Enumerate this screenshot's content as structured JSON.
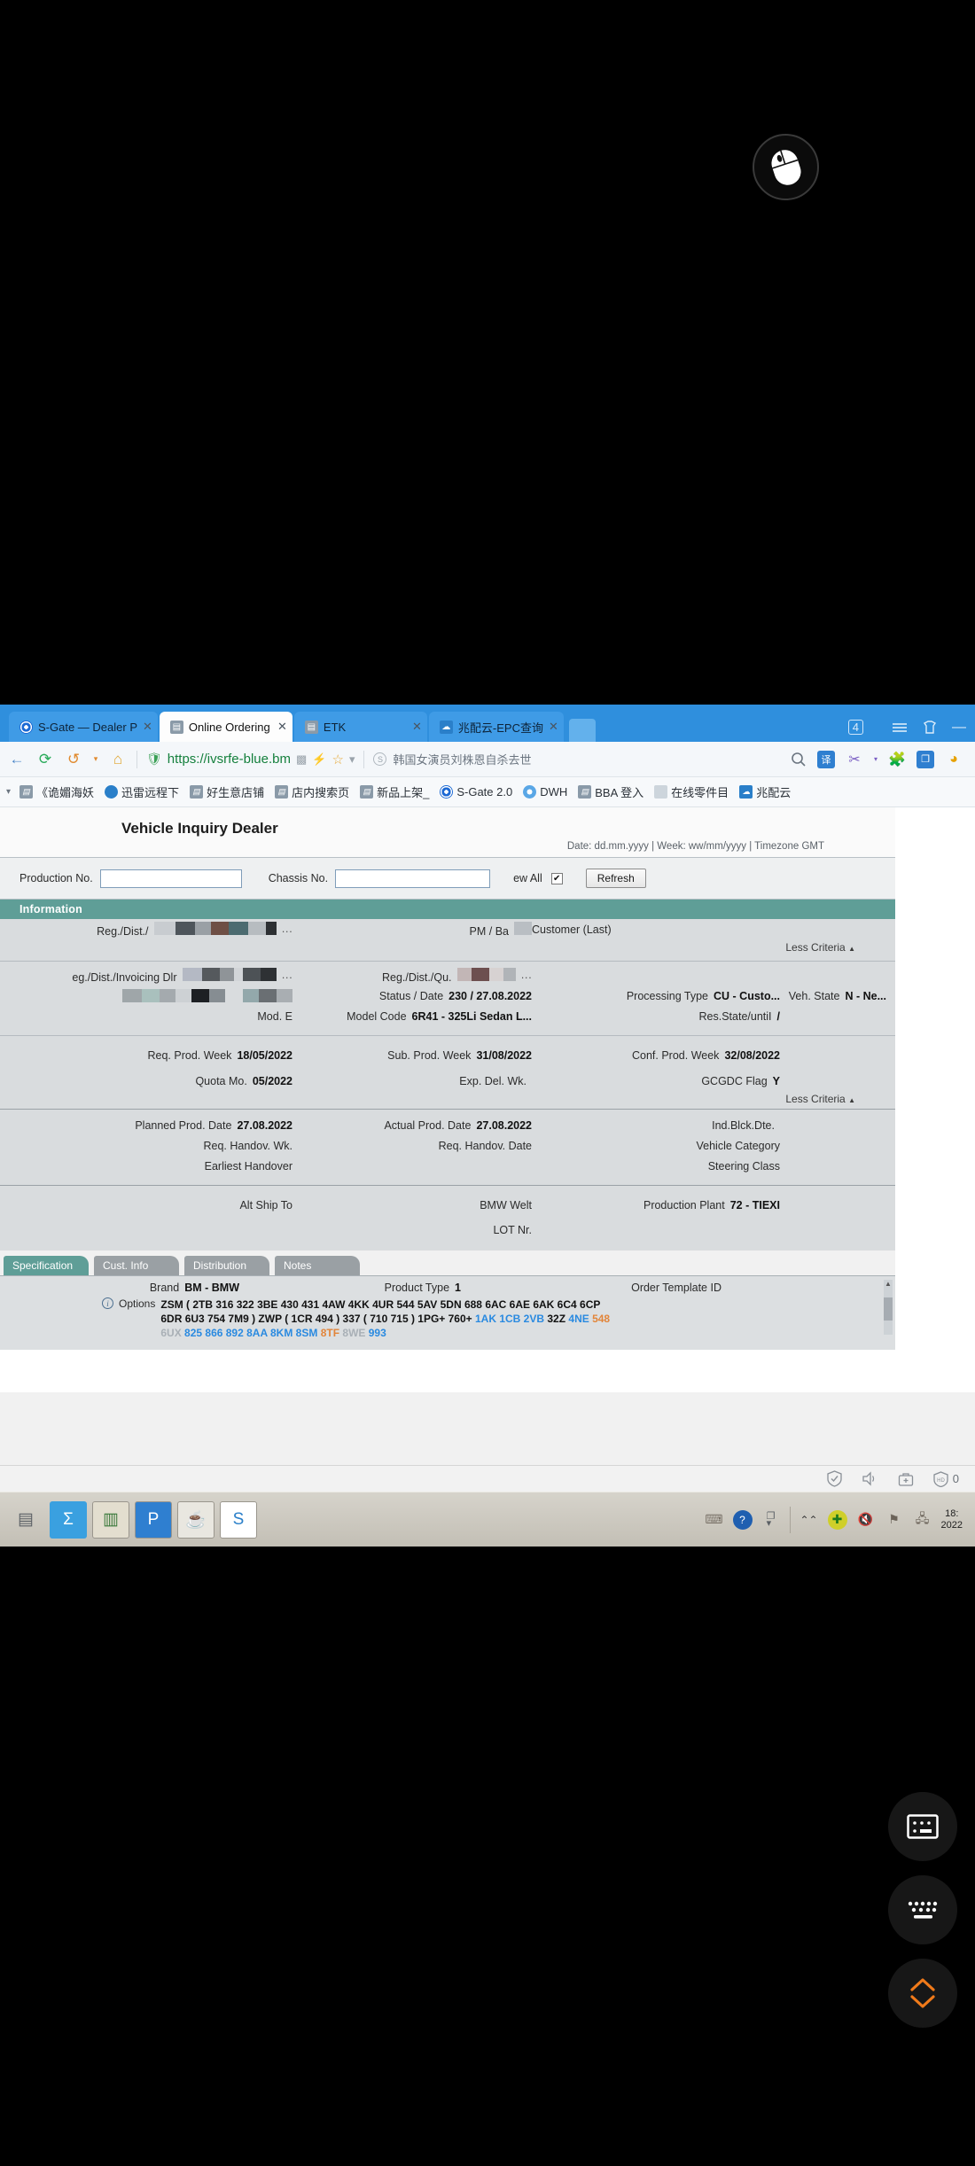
{
  "overlay": {
    "mouse_icon": "mouse-pointer-icon"
  },
  "browser": {
    "tabs": [
      {
        "title": "S-Gate — Dealer P",
        "icon": "bmw-favicon",
        "close": "✕",
        "active": false
      },
      {
        "title": "Online Ordering",
        "icon": "document-favicon",
        "close": "✕",
        "active": true
      },
      {
        "title": "ETK",
        "icon": "document-favicon",
        "close": "✕",
        "active": false
      },
      {
        "title": "兆配云-EPC查询",
        "icon": "blue-cloud-favicon",
        "close": "✕",
        "active": false
      }
    ],
    "window_controls": {
      "count_badge": "4",
      "menu_icon": "hamburger-menu-icon",
      "shirt_icon": "skin-icon",
      "minimize": "—"
    },
    "toolbar": {
      "back_icon": "←",
      "reload_icon": "⟳",
      "history_icon": "↺",
      "history_caret": "▾",
      "home_icon": "⌂",
      "site_shield_icon": "🛡",
      "url": "https://ivsrfe-blue.bm",
      "qr_icon": "qr-code-icon",
      "lightning_icon": "⚡",
      "star_icon": "☆",
      "star_caret": "▾",
      "search_engine_icon": "S",
      "search_text": "韩国女演员刘株恩自杀去世",
      "search_icon": "search-icon",
      "right_icons": [
        "translate-icon",
        "scissors-icon",
        "scissors-caret",
        "puzzle-extension-icon",
        "copy-window-icon",
        "account-icon"
      ]
    },
    "bookmarks_caret": "▾",
    "bookmarks": [
      {
        "label": "《诡媚海妖",
        "icon": "document-favicon"
      },
      {
        "label": "迅雷远程下",
        "icon": "xunlei-favicon"
      },
      {
        "label": "好生意店铺",
        "icon": "document-favicon"
      },
      {
        "label": "店内搜索页",
        "icon": "document-favicon"
      },
      {
        "label": "新品上架_",
        "icon": "document-favicon"
      },
      {
        "label": "S-Gate 2.0",
        "icon": "bmw-favicon"
      },
      {
        "label": "DWH",
        "icon": "dwh-favicon"
      },
      {
        "label": "BBA 登入",
        "icon": "document-favicon"
      },
      {
        "label": "在线零件目",
        "icon": "faint-favicon"
      },
      {
        "label": "兆配云",
        "icon": "blue-cloud-favicon"
      }
    ]
  },
  "app": {
    "title": "Vehicle Inquiry Dealer",
    "datebar": "Date: dd.mm.yyyy | Week: ww/mm/yyyy | Timezone GMT",
    "criteria": {
      "production_no_label": "Production No.",
      "chassis_no_label": "Chassis No.",
      "view_all_label": "ew All",
      "view_all_checked": "✔",
      "refresh_label": "Refresh"
    },
    "section_title": "Information",
    "less_criteria_label": "Less Criteria",
    "less_criteria_caret": "▲",
    "fields": {
      "reg_dist_label": "Reg./Dist./",
      "pm_ba_label": "PM / Ba",
      "customer_last_label": "Customer (Last)",
      "reg_dist_invoicing_label": "eg./Dist./Invoicing Dlr",
      "reg_dist_qu_label": "Reg./Dist./Qu.",
      "mod_e_label": "Mod. E",
      "status_date_label": "Status / Date",
      "status_date_value": "230 / 27.08.2022",
      "processing_type_label": "Processing Type",
      "processing_type_value": "CU - Custo...",
      "veh_state_label": "Veh. State",
      "veh_state_value": "N - Ne...",
      "model_code_label": "Model Code",
      "model_code_value": "6R41 - 325Li Sedan L...",
      "res_state_label": "Res.State/untiI",
      "res_state_value": "/",
      "req_prod_week_label": "Req. Prod. Week",
      "req_prod_week_value": "18/05/2022",
      "sub_prod_week_label": "Sub. Prod. Week",
      "sub_prod_week_value": "31/08/2022",
      "conf_prod_week_label": "Conf. Prod. Week",
      "conf_prod_week_value": "32/08/2022",
      "quota_mo_label": "Quota Mo.",
      "quota_mo_value": "05/2022",
      "exp_del_wk_label": "Exp. Del. Wk.",
      "exp_del_wk_value": "",
      "gcgdc_flag_label": "GCGDC Flag",
      "gcgdc_flag_value": "Y",
      "planned_prod_date_label": "Planned Prod. Date",
      "planned_prod_date_value": "27.08.2022",
      "actual_prod_date_label": "Actual Prod. Date",
      "actual_prod_date_value": "27.08.2022",
      "ind_blck_dte_label": "Ind.Blck.Dte.",
      "ind_blck_dte_value": "",
      "req_handov_wk_label": "Req. Handov. Wk.",
      "req_handov_date_label": "Req. Handov. Date",
      "vehicle_category_label": "Vehicle Category",
      "earliest_handover_label": "Earliest Handover",
      "steering_class_label": "Steering Class",
      "alt_ship_to_label": "Alt Ship To",
      "bmw_welt_label": "BMW Welt",
      "production_plant_label": "Production Plant",
      "production_plant_value": "72 - TIEXI",
      "lot_nr_label": "LOT Nr."
    },
    "tabs": [
      {
        "label": "Specification",
        "active": true
      },
      {
        "label": "Cust. Info",
        "active": false
      },
      {
        "label": "Distribution",
        "active": false
      },
      {
        "label": "Notes",
        "active": false
      }
    ],
    "specification": {
      "brand_label": "Brand",
      "brand_value": "BM - BMW",
      "product_type_label": "Product Type",
      "product_type_value": "1",
      "order_template_id_label": "Order Template ID",
      "order_template_id_value": "",
      "options_label": "Options",
      "options_info_icon": "info-icon",
      "options_line1": "ZSM ( 2TB 316 322 3BE 430 431 4AW 4KK 4UR 544 5AV 5DN 688 6AC 6AE 6AK 6C4 6CP 6DR 6U3 754 7M9 ) ZWP (",
      "options_line2_plain_a": "1CR 494 ) 337 ( 710 715 ) 1PG+ 760+ ",
      "options_line2_blue_a": "1AK 1CB 2VB",
      "options_line2_plain_b": " 32Z ",
      "options_line2_blue_b": "4NE",
      "options_line2_orange": "548",
      "options_line2_grey": "6UX",
      "options_line2_blue_c": "825 866 892 8AA 8KM 8SM",
      "options_line2_orange_b": "8TF",
      "options_line2_grey_b": "8WE",
      "options_line2_blue_d": "993"
    }
  },
  "statusbar": {
    "icons": [
      "shield-check-icon",
      "speaker-icon",
      "briefcase-plus-icon",
      "hd-shield-icon"
    ],
    "count": "0"
  },
  "taskbar": {
    "apps": [
      {
        "name": "shredder-icon",
        "glyph": "▤"
      },
      {
        "name": "powershell-icon",
        "glyph": "Σ"
      },
      {
        "name": "file-explorer-icon",
        "glyph": "▥"
      },
      {
        "name": "pdf-reader-icon",
        "glyph": "P"
      },
      {
        "name": "java-icon",
        "glyph": "☕"
      },
      {
        "name": "s-app-icon",
        "glyph": "S"
      }
    ],
    "tray": [
      "keyboard-layout-icon",
      "help-icon",
      "expand-icon",
      "show-hidden-icon",
      "antivirus-icon",
      "mute-icon",
      "flag-icon",
      "network-icon"
    ],
    "clock_time": "18:",
    "clock_date": "2022"
  },
  "fabs": [
    {
      "name": "input-panel-button",
      "icon": "input-panel-icon"
    },
    {
      "name": "keyboard-button",
      "icon": "keyboard-icon"
    },
    {
      "name": "scroll-toggle-button",
      "icon": "scroll-updown-icon"
    }
  ],
  "colors": {
    "teal": "#5f9e97",
    "browser_blue": "#2f8fdd",
    "accent_orange": "#e2853a",
    "option_blue": "#2a8ae0"
  }
}
